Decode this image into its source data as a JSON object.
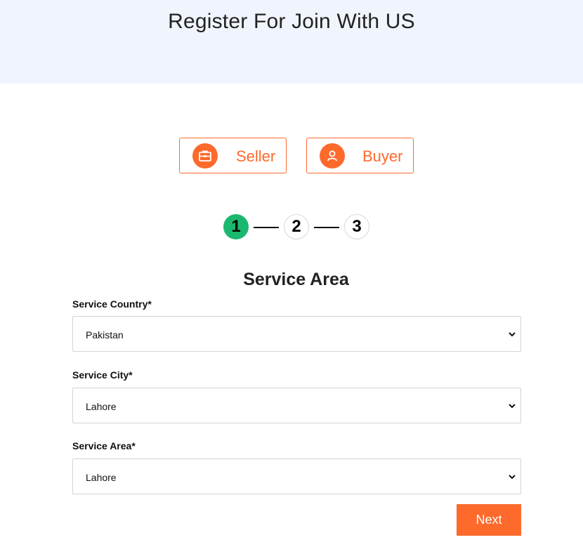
{
  "header": {
    "title": "Register For Join With US"
  },
  "roles": [
    {
      "label": "Seller",
      "icon": "briefcase-icon"
    },
    {
      "label": "Buyer",
      "icon": "user-icon"
    }
  ],
  "steps": [
    "1",
    "2",
    "3"
  ],
  "active_step": 1,
  "section": {
    "title": "Service Area"
  },
  "fields": {
    "country": {
      "label": "Service Country*",
      "value": "Pakistan"
    },
    "city": {
      "label": "Service City*",
      "value": "Lahore"
    },
    "area": {
      "label": "Service Area*",
      "value": "Lahore"
    }
  },
  "actions": {
    "next_label": "Next"
  },
  "colors": {
    "accent": "#fd6a2c",
    "step_active": "#1ab86e",
    "hero_bg": "#f0f5fd"
  }
}
